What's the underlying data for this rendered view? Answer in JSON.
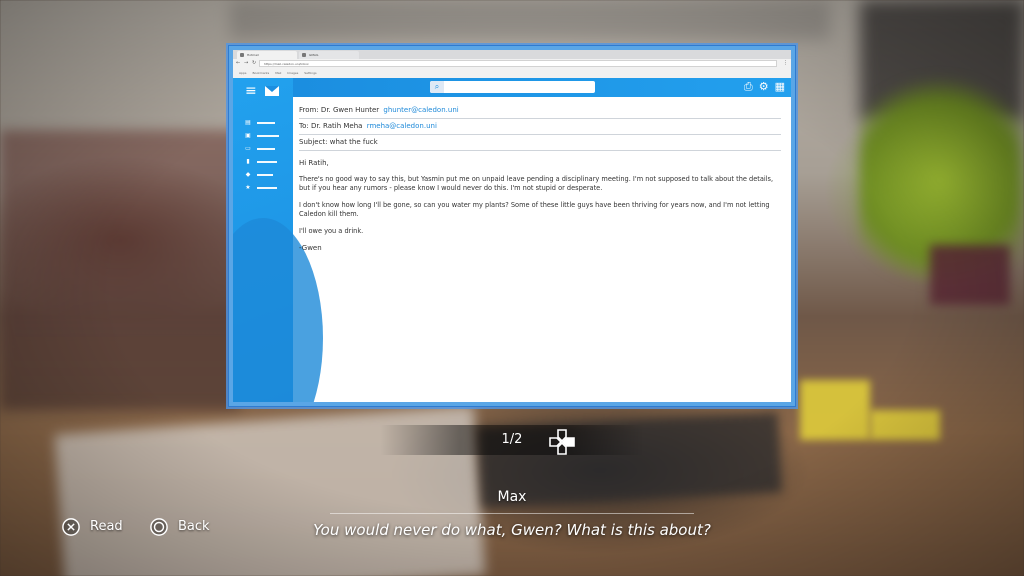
{
  "browser": {
    "tabs": [
      "Hotmail",
      "GMAIL"
    ],
    "url": "https://mail.caledon.uni/inbox",
    "bookmarks": [
      "Apps",
      "Bookmarks",
      "Mail",
      "Images",
      "Settings"
    ]
  },
  "mail_app": {
    "search": {
      "placeholder": ""
    },
    "tool_icons": [
      "print-icon",
      "gear-icon",
      "apps-grid-icon"
    ]
  },
  "email": {
    "from_label": "From: Dr. Gwen Hunter",
    "from_address": "ghunter@caledon.uni",
    "to_label": "To: Dr. Ratih Meha",
    "to_address": "rmeha@caledon.uni",
    "subject": "Subject: what the fuck",
    "greeting": "Hi Ratih,",
    "paragraphs": [
      "There's no good way to say this, but Yasmin put me on unpaid leave pending a disciplinary meeting. I'm not supposed to talk about the details, but if you hear any rumors - please know I would never do this. I'm not stupid or desperate.",
      "I don't know how long I'll be gone, so can you water my plants? Some of these little guys have been thriving for years now, and I'm not letting Caledon kill them.",
      "I'll owe you a drink."
    ],
    "signoff": "-Gwen"
  },
  "pager": {
    "page": "1/2"
  },
  "dialogue": {
    "speaker": "Max",
    "line": "You would never do what, Gwen? What is this about?"
  },
  "prompts": {
    "read": "Read",
    "back": "Back"
  },
  "colors": {
    "accent": "#1b8ee0",
    "link": "#1f8ad9",
    "window_border": "#2f7bd0"
  }
}
